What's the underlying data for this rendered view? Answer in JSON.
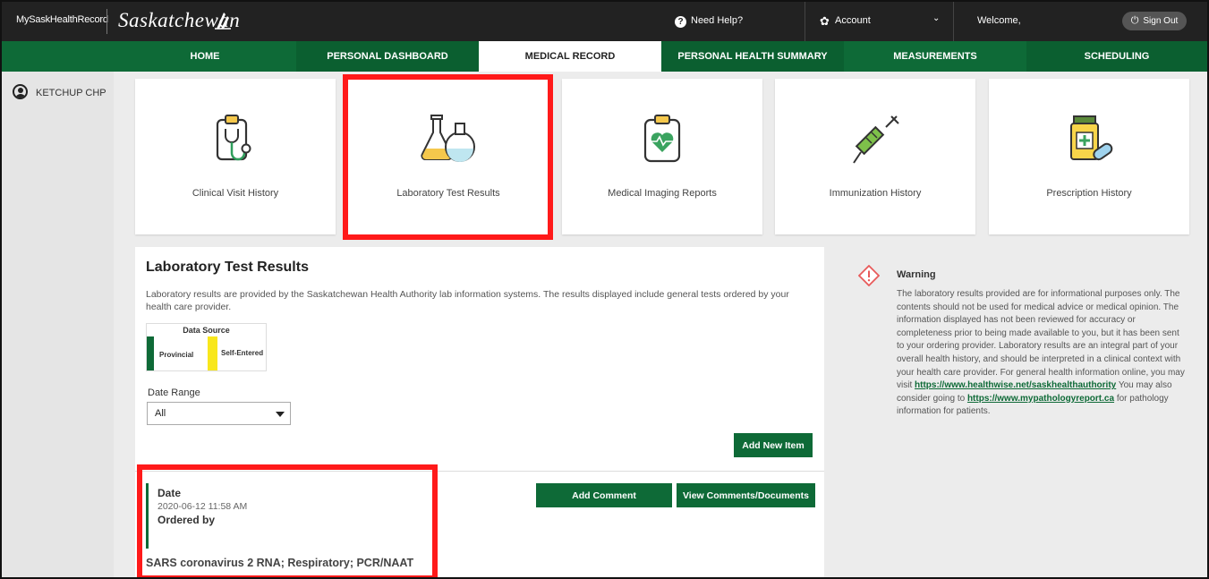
{
  "header": {
    "brand_text": "MySaskHealthRecord",
    "logo_text": "Saskatchewan",
    "help_label": "Need Help?",
    "account_label": "Account",
    "welcome_label": "Welcome,",
    "signout_label": "Sign Out",
    "icons": [
      "help-icon",
      "gear-icon",
      "chevron-down-icon",
      "power-icon"
    ]
  },
  "nav": {
    "items": [
      {
        "label": "HOME"
      },
      {
        "label": "PERSONAL DASHBOARD"
      },
      {
        "label": "MEDICAL RECORD",
        "active": true
      },
      {
        "label": "PERSONAL HEALTH SUMMARY"
      },
      {
        "label": "MEASUREMENTS"
      },
      {
        "label": "SCHEDULING"
      }
    ]
  },
  "sidebar": {
    "user_name": "KETCHUP CHP"
  },
  "tiles": [
    {
      "label": "Clinical Visit History",
      "icon": "clipboard-stethoscope-icon"
    },
    {
      "label": "Laboratory Test Results",
      "icon": "lab-flasks-icon",
      "highlighted": true
    },
    {
      "label": "Medical Imaging Reports",
      "icon": "clipboard-heart-icon"
    },
    {
      "label": "Immunization History",
      "icon": "syringe-icon"
    },
    {
      "label": "Prescription History",
      "icon": "pill-bottle-icon"
    }
  ],
  "lab_results": {
    "title": "Laboratory Test Results",
    "description": "Laboratory results are provided by the Saskatchewan Health Authority lab information systems. The results displayed include general tests ordered by your health care provider.",
    "data_source": {
      "title": "Data Source",
      "provincial_label": "Provincial",
      "self_entered_label": "Self-Entered"
    },
    "date_range": {
      "label": "Date Range",
      "value": "All"
    },
    "add_new_label": "Add New Item",
    "entry": {
      "date_label": "Date",
      "date_value": "2020-06-12 11:58 AM",
      "ordered_by_label": "Ordered by",
      "test_name": "SARS coronavirus 2 RNA; Respiratory; PCR/NAAT",
      "add_comment_label": "Add Comment",
      "view_comments_label": "View Comments/Documents"
    }
  },
  "warning": {
    "title": "Warning",
    "body_1": "The laboratory results provided are for informational purposes only. The contents should not be used for medical advice or medical opinion. The information displayed has not been reviewed for accuracy or completeness prior to being made available to you, but it has been sent to your ordering provider. Laboratory results are an integral part of your overall health history, and should be interpreted in a clinical context with your health care provider. For general health information online, you may visit ",
    "link_1": "https://www.healthwise.net/saskhealthauthority",
    "body_2": " You may also consider going to ",
    "link_2": "https://www.mypathologyreport.ca",
    "body_3": " for pathology information for patients."
  },
  "colors": {
    "brand_green": "#0e6a37",
    "top_bar": "#222222",
    "highlight_red": "#ff1a1a",
    "self_entered_yellow": "#f8e71c"
  }
}
